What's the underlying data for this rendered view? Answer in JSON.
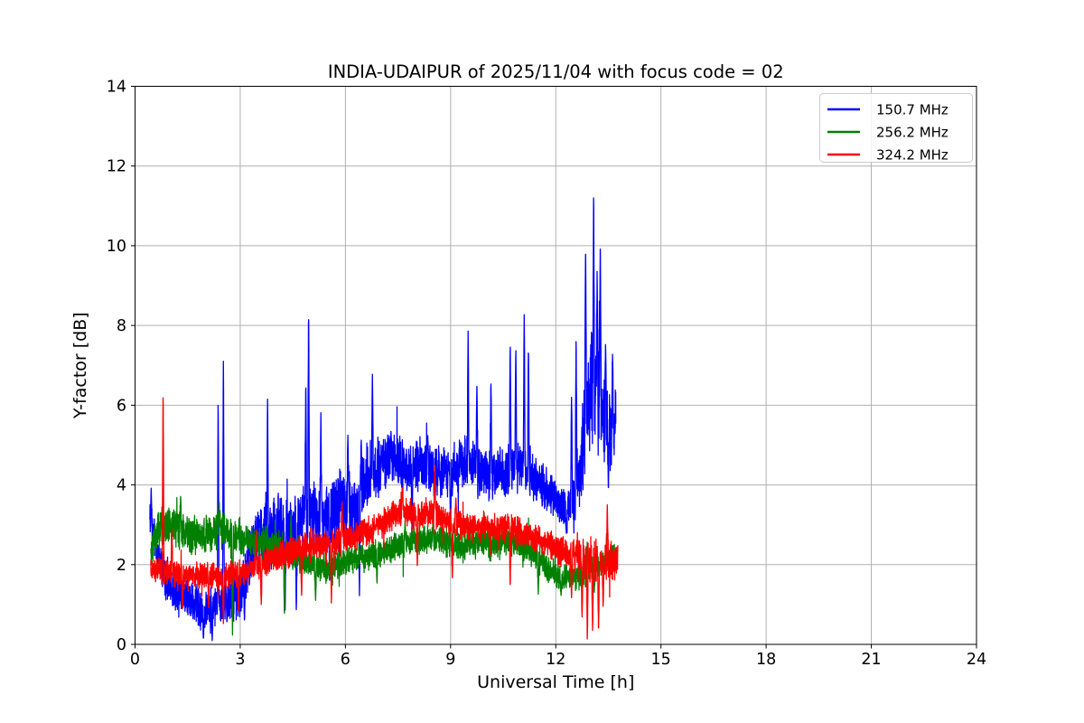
{
  "chart_data": {
    "type": "line",
    "title": "INDIA-UDAIPUR of 2025/11/04 with focus code = 02",
    "xlabel": "Universal Time [h]",
    "ylabel": "Y-factor [dB]",
    "xlim": [
      0,
      24
    ],
    "ylim": [
      0,
      14
    ],
    "xticks": [
      0,
      3,
      6,
      9,
      12,
      15,
      18,
      21,
      24
    ],
    "yticks": [
      0,
      2,
      4,
      6,
      8,
      10,
      12,
      14
    ],
    "grid": true,
    "grid_color": "#b0b0b0",
    "background_color": "#ffffff",
    "axis_color": "#000000",
    "legend": {
      "position": "upper-right",
      "border_color": "#cccccc"
    },
    "series": [
      {
        "name": "150.7 MHz",
        "color": "#0000ff",
        "x_start": 0.42,
        "x_end": 13.72,
        "trend": [
          [
            0.42,
            3.2
          ],
          [
            0.5,
            2.9
          ],
          [
            0.65,
            2.2
          ],
          [
            0.8,
            1.85
          ],
          [
            1.0,
            1.5
          ],
          [
            1.2,
            1.35
          ],
          [
            1.5,
            1.15
          ],
          [
            1.8,
            0.95
          ],
          [
            2.0,
            0.8
          ],
          [
            2.15,
            0.85
          ],
          [
            2.3,
            1.05
          ],
          [
            2.5,
            1.15
          ],
          [
            2.7,
            1.1
          ],
          [
            2.9,
            1.2
          ],
          [
            3.1,
            1.5
          ],
          [
            3.3,
            2.3
          ],
          [
            3.5,
            2.6
          ],
          [
            3.7,
            2.7
          ],
          [
            3.9,
            2.85
          ],
          [
            4.1,
            3.0
          ],
          [
            4.3,
            2.9
          ],
          [
            4.5,
            2.8
          ],
          [
            4.7,
            3.1
          ],
          [
            4.9,
            3.3
          ],
          [
            5.1,
            3.25
          ],
          [
            5.3,
            3.1
          ],
          [
            5.5,
            3.3
          ],
          [
            5.7,
            3.4
          ],
          [
            5.9,
            3.55
          ],
          [
            6.1,
            3.5
          ],
          [
            6.3,
            3.2
          ],
          [
            6.5,
            3.9
          ],
          [
            6.7,
            4.35
          ],
          [
            6.9,
            4.5
          ],
          [
            7.1,
            4.55
          ],
          [
            7.3,
            4.6
          ],
          [
            7.5,
            4.55
          ],
          [
            7.7,
            4.5
          ],
          [
            7.9,
            4.4
          ],
          [
            8.1,
            4.5
          ],
          [
            8.3,
            4.5
          ],
          [
            8.5,
            4.4
          ],
          [
            8.7,
            4.3
          ],
          [
            8.9,
            4.35
          ],
          [
            9.1,
            4.4
          ],
          [
            9.3,
            4.5
          ],
          [
            9.5,
            4.5
          ],
          [
            9.7,
            4.35
          ],
          [
            9.9,
            4.2
          ],
          [
            10.1,
            4.25
          ],
          [
            10.3,
            4.3
          ],
          [
            10.5,
            4.35
          ],
          [
            10.7,
            4.4
          ],
          [
            10.9,
            4.45
          ],
          [
            11.1,
            4.5
          ],
          [
            11.3,
            4.25
          ],
          [
            11.5,
            4.05
          ],
          [
            11.7,
            3.9
          ],
          [
            11.9,
            3.7
          ],
          [
            12.1,
            3.55
          ],
          [
            12.3,
            3.4
          ],
          [
            12.5,
            3.55
          ],
          [
            12.7,
            4.4
          ],
          [
            12.85,
            5.6
          ],
          [
            13.0,
            6.2
          ],
          [
            13.1,
            6.6
          ],
          [
            13.2,
            6.1
          ],
          [
            13.3,
            5.6
          ],
          [
            13.45,
            5.3
          ],
          [
            13.6,
            5.4
          ],
          [
            13.72,
            5.5
          ]
        ],
        "noise": [
          [
            0.42,
            0.45
          ],
          [
            1.0,
            0.5
          ],
          [
            2.0,
            0.45
          ],
          [
            3.0,
            0.55
          ],
          [
            4.0,
            0.7
          ],
          [
            5.0,
            0.7
          ],
          [
            6.0,
            0.7
          ],
          [
            7.0,
            0.6
          ],
          [
            8.0,
            0.55
          ],
          [
            9.0,
            0.55
          ],
          [
            10.0,
            0.55
          ],
          [
            11.0,
            0.5
          ],
          [
            11.8,
            0.45
          ],
          [
            12.4,
            0.4
          ],
          [
            12.8,
            1.15
          ],
          [
            13.1,
            1.35
          ],
          [
            13.3,
            1.05
          ],
          [
            13.72,
            0.8
          ]
        ],
        "spikes": [
          [
            0.46,
            3.95
          ],
          [
            2.37,
            6.2
          ],
          [
            2.52,
            7.1
          ],
          [
            3.78,
            6.15
          ],
          [
            4.87,
            6.6
          ],
          [
            4.95,
            8.4
          ],
          [
            5.3,
            5.85
          ],
          [
            6.07,
            5.3
          ],
          [
            6.45,
            5.15
          ],
          [
            6.77,
            6.8
          ],
          [
            7.3,
            5.35
          ],
          [
            8.35,
            5.25
          ],
          [
            9.5,
            7.9
          ],
          [
            9.75,
            6.6
          ],
          [
            10.15,
            6.65
          ],
          [
            10.7,
            7.6
          ],
          [
            10.86,
            7.5
          ],
          [
            11.1,
            8.35
          ],
          [
            11.22,
            7.5
          ],
          [
            12.45,
            6.3
          ],
          [
            12.58,
            7.7
          ],
          [
            12.85,
            10.1
          ],
          [
            13.08,
            11.45
          ],
          [
            13.18,
            9.4
          ],
          [
            13.27,
            10.2
          ],
          [
            13.42,
            7.6
          ],
          [
            13.62,
            7.3
          ]
        ],
        "dips": [
          [
            1.95,
            0.12
          ],
          [
            2.2,
            0.08
          ],
          [
            2.62,
            0.55
          ],
          [
            3.12,
            0.6
          ],
          [
            4.28,
            0.85
          ],
          [
            4.6,
            0.8
          ],
          [
            5.55,
            1.5
          ],
          [
            6.4,
            1.15
          ],
          [
            7.9,
            2.9
          ],
          [
            9.0,
            3.0
          ],
          [
            12.3,
            2.75
          ],
          [
            13.5,
            3.9
          ]
        ]
      },
      {
        "name": "256.2 MHz",
        "color": "#008000",
        "x_start": 0.45,
        "x_end": 13.68,
        "trend": [
          [
            0.45,
            2.35
          ],
          [
            0.6,
            2.7
          ],
          [
            0.8,
            2.95
          ],
          [
            1.0,
            3.0
          ],
          [
            1.2,
            2.95
          ],
          [
            1.4,
            2.85
          ],
          [
            1.6,
            2.75
          ],
          [
            1.8,
            2.7
          ],
          [
            2.0,
            2.75
          ],
          [
            2.2,
            2.8
          ],
          [
            2.4,
            2.9
          ],
          [
            2.6,
            2.85
          ],
          [
            2.8,
            2.75
          ],
          [
            3.0,
            2.7
          ],
          [
            3.2,
            2.65
          ],
          [
            3.4,
            2.6
          ],
          [
            3.6,
            2.55
          ],
          [
            3.8,
            2.5
          ],
          [
            4.0,
            2.45
          ],
          [
            4.2,
            2.35
          ],
          [
            4.4,
            2.3
          ],
          [
            4.6,
            2.2
          ],
          [
            4.8,
            2.1
          ],
          [
            5.0,
            2.05
          ],
          [
            5.2,
            1.95
          ],
          [
            5.4,
            1.9
          ],
          [
            5.6,
            1.95
          ],
          [
            5.8,
            2.0
          ],
          [
            6.0,
            2.1
          ],
          [
            6.2,
            2.15
          ],
          [
            6.4,
            2.2
          ],
          [
            6.6,
            2.2
          ],
          [
            6.8,
            2.25
          ],
          [
            7.0,
            2.3
          ],
          [
            7.2,
            2.35
          ],
          [
            7.4,
            2.45
          ],
          [
            7.6,
            2.5
          ],
          [
            7.8,
            2.55
          ],
          [
            8.0,
            2.6
          ],
          [
            8.2,
            2.6
          ],
          [
            8.4,
            2.65
          ],
          [
            8.6,
            2.65
          ],
          [
            8.8,
            2.6
          ],
          [
            9.0,
            2.55
          ],
          [
            9.2,
            2.5
          ],
          [
            9.4,
            2.5
          ],
          [
            9.6,
            2.55
          ],
          [
            9.8,
            2.6
          ],
          [
            10.0,
            2.6
          ],
          [
            10.2,
            2.55
          ],
          [
            10.4,
            2.55
          ],
          [
            10.6,
            2.6
          ],
          [
            10.8,
            2.55
          ],
          [
            11.0,
            2.5
          ],
          [
            11.2,
            2.4
          ],
          [
            11.4,
            2.25
          ],
          [
            11.6,
            2.1
          ],
          [
            11.8,
            1.9
          ],
          [
            12.0,
            1.75
          ],
          [
            12.2,
            1.7
          ],
          [
            12.4,
            1.8
          ],
          [
            12.6,
            1.7
          ],
          [
            12.8,
            1.75
          ],
          [
            13.0,
            1.85
          ],
          [
            13.2,
            1.95
          ],
          [
            13.4,
            2.05
          ],
          [
            13.55,
            2.1
          ],
          [
            13.68,
            2.2
          ]
        ],
        "noise": [
          [
            0.45,
            0.42
          ],
          [
            2.0,
            0.4
          ],
          [
            4.0,
            0.35
          ],
          [
            6.0,
            0.3
          ],
          [
            8.0,
            0.3
          ],
          [
            10.0,
            0.3
          ],
          [
            12.0,
            0.3
          ],
          [
            13.68,
            0.3
          ]
        ],
        "spikes": [
          [
            1.3,
            3.75
          ],
          [
            2.4,
            3.6
          ],
          [
            4.45,
            3.3
          ],
          [
            7.7,
            3.1
          ],
          [
            8.5,
            3.2
          ],
          [
            12.9,
            2.6
          ],
          [
            13.45,
            2.8
          ]
        ],
        "dips": [
          [
            2.78,
            0.15
          ],
          [
            4.26,
            0.75
          ],
          [
            5.15,
            1.1
          ],
          [
            6.9,
            1.5
          ],
          [
            11.5,
            1.25
          ],
          [
            12.15,
            1.2
          ],
          [
            13.1,
            1.3
          ]
        ]
      },
      {
        "name": "324.2 MHz",
        "color": "#ff0000",
        "x_start": 0.45,
        "x_end": 13.77,
        "trend": [
          [
            0.45,
            1.85
          ],
          [
            0.8,
            1.8
          ],
          [
            1.1,
            1.75
          ],
          [
            1.4,
            1.7
          ],
          [
            1.7,
            1.72
          ],
          [
            2.0,
            1.7
          ],
          [
            2.3,
            1.72
          ],
          [
            2.6,
            1.75
          ],
          [
            2.9,
            1.78
          ],
          [
            3.2,
            1.85
          ],
          [
            3.5,
            2.0
          ],
          [
            3.8,
            2.1
          ],
          [
            4.1,
            2.2
          ],
          [
            4.4,
            2.3
          ],
          [
            4.7,
            2.4
          ],
          [
            5.0,
            2.5
          ],
          [
            5.3,
            2.5
          ],
          [
            5.6,
            2.55
          ],
          [
            5.9,
            2.65
          ],
          [
            6.2,
            2.7
          ],
          [
            6.5,
            2.8
          ],
          [
            6.8,
            2.9
          ],
          [
            7.1,
            3.05
          ],
          [
            7.4,
            3.25
          ],
          [
            7.6,
            3.35
          ],
          [
            7.8,
            3.3
          ],
          [
            8.0,
            3.2
          ],
          [
            8.2,
            3.25
          ],
          [
            8.4,
            3.35
          ],
          [
            8.6,
            3.25
          ],
          [
            8.8,
            3.1
          ],
          [
            9.0,
            3.05
          ],
          [
            9.2,
            3.0
          ],
          [
            9.4,
            3.0
          ],
          [
            9.6,
            2.95
          ],
          [
            9.8,
            2.9
          ],
          [
            10.0,
            2.9
          ],
          [
            10.2,
            2.9
          ],
          [
            10.4,
            2.95
          ],
          [
            10.6,
            3.0
          ],
          [
            10.8,
            2.95
          ],
          [
            11.0,
            2.85
          ],
          [
            11.2,
            2.75
          ],
          [
            11.4,
            2.65
          ],
          [
            11.6,
            2.6
          ],
          [
            11.8,
            2.5
          ],
          [
            12.0,
            2.4
          ],
          [
            12.2,
            2.3
          ],
          [
            12.4,
            2.25
          ],
          [
            12.6,
            2.2
          ],
          [
            12.8,
            2.15
          ],
          [
            13.0,
            2.1
          ],
          [
            13.2,
            2.05
          ],
          [
            13.35,
            2.0
          ],
          [
            13.5,
            2.1
          ],
          [
            13.65,
            2.05
          ],
          [
            13.77,
            2.1
          ]
        ],
        "noise": [
          [
            0.45,
            0.28
          ],
          [
            2.0,
            0.28
          ],
          [
            4.0,
            0.3
          ],
          [
            6.0,
            0.3
          ],
          [
            8.0,
            0.3
          ],
          [
            10.0,
            0.28
          ],
          [
            11.0,
            0.3
          ],
          [
            12.0,
            0.3
          ],
          [
            12.6,
            0.4
          ],
          [
            13.0,
            0.5
          ],
          [
            13.3,
            0.45
          ],
          [
            13.77,
            0.35
          ]
        ],
        "spikes": [
          [
            0.8,
            6.4
          ],
          [
            1.05,
            2.9
          ],
          [
            3.45,
            2.9
          ],
          [
            5.9,
            3.6
          ],
          [
            7.62,
            3.95
          ],
          [
            8.55,
            4.55
          ],
          [
            9.15,
            3.7
          ],
          [
            13.47,
            3.5
          ]
        ],
        "dips": [
          [
            1.35,
            0.85
          ],
          [
            2.1,
            0.9
          ],
          [
            2.52,
            0.5
          ],
          [
            2.95,
            0.8
          ],
          [
            3.6,
            1.0
          ],
          [
            4.75,
            1.2
          ],
          [
            5.6,
            1.0
          ],
          [
            8.05,
            1.9
          ],
          [
            9.05,
            1.6
          ],
          [
            10.7,
            1.4
          ],
          [
            12.45,
            1.15
          ],
          [
            12.75,
            0.6
          ],
          [
            12.9,
            0.05
          ],
          [
            13.05,
            0.35
          ],
          [
            13.22,
            0.3
          ],
          [
            13.35,
            0.9
          ]
        ]
      }
    ]
  }
}
